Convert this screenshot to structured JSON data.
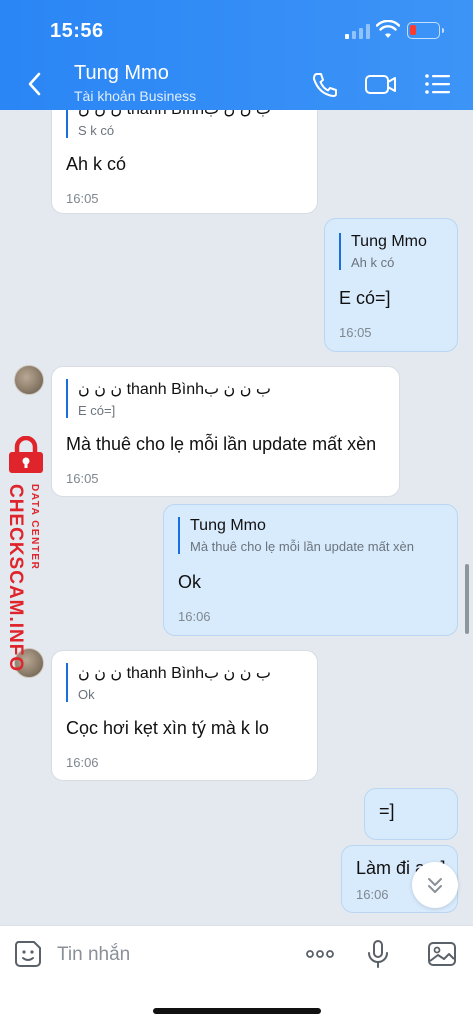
{
  "status_bar": {
    "time": "15:56"
  },
  "header": {
    "title": "Tung Mmo",
    "subtitle": "Tài khoản Business"
  },
  "messages": [
    {
      "dir": "in",
      "quote_name": "ن ن ن thanh Bìnhب ن ن ب",
      "quote_text": "S k có",
      "text": "Ah k có",
      "time": "16:05"
    },
    {
      "dir": "out",
      "quote_name": "Tung Mmo",
      "quote_text": "Ah k có",
      "text": "E có=]",
      "time": "16:05"
    },
    {
      "dir": "in",
      "quote_name": "ن ن ن thanh Bìnhب ن ن ب",
      "quote_text": "E có=]",
      "text": "Mà thuê cho lẹ mỗi lần update mất xèn",
      "time": "16:05"
    },
    {
      "dir": "out",
      "quote_name": "Tung Mmo",
      "quote_text": "Mà thuê cho lẹ mỗi lần update mất xèn",
      "text": "Ok",
      "time": "16:06"
    },
    {
      "dir": "in",
      "quote_name": "ن ن ن thanh Bìnhب ن ن ب",
      "quote_text": "Ok",
      "text": "Cọc hơi kẹt xìn tý mà k lo",
      "time": "16:06"
    },
    {
      "dir": "out",
      "text": "=]"
    },
    {
      "dir": "out",
      "text": "Làm đi a =]",
      "time": "16:06"
    }
  ],
  "watermark": {
    "main": "CHECKSCAM.INFO",
    "sub": "DATA CENTER"
  },
  "input": {
    "placeholder": "Tin nhắn"
  },
  "colors": {
    "header": "#2a86f5",
    "out_bubble": "#d8ebfd",
    "in_bubble": "#ffffff",
    "background": "#e3e9ef",
    "watermark": "#e0242c"
  }
}
